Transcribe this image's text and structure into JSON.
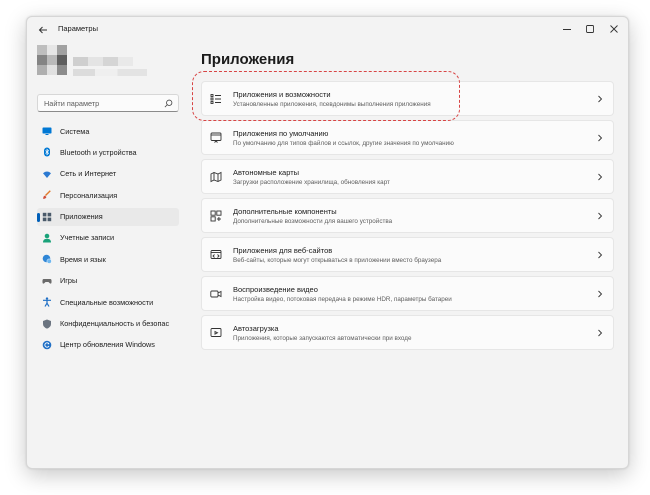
{
  "window": {
    "title": "Параметры"
  },
  "sidebar": {
    "search_placeholder": "Найти параметр",
    "items": [
      {
        "label": "Система",
        "icon": "monitor-icon",
        "color": "#0078d4"
      },
      {
        "label": "Bluetooth и устройства",
        "icon": "bluetooth-icon",
        "color": "#0078d4"
      },
      {
        "label": "Сеть и Интернет",
        "icon": "wifi-icon",
        "color": "#2b79d1"
      },
      {
        "label": "Персонализация",
        "icon": "brush-icon",
        "color": "#e07a2a"
      },
      {
        "label": "Приложения",
        "icon": "apps-icon",
        "color": "#4a5a6a",
        "active": true
      },
      {
        "label": "Учетные записи",
        "icon": "person-icon",
        "color": "#1aa37a"
      },
      {
        "label": "Время и язык",
        "icon": "globe-clock-icon",
        "color": "#2f86d6"
      },
      {
        "label": "Игры",
        "icon": "gamepad-icon",
        "color": "#6a6a6a"
      },
      {
        "label": "Специальные возможности",
        "icon": "accessibility-icon",
        "color": "#1f6fc5"
      },
      {
        "label": "Конфиденциальность и безопас",
        "icon": "shield-icon",
        "color": "#6b7480"
      },
      {
        "label": "Центр обновления Windows",
        "icon": "update-icon",
        "color": "#1f6fc5"
      }
    ]
  },
  "main": {
    "title": "Приложения",
    "cards": [
      {
        "title": "Приложения и возможности",
        "desc": "Установленные приложения, псевдонимы выполнения приложения",
        "icon": "apps-list-icon"
      },
      {
        "title": "Приложения по умолчанию",
        "desc": "По умолчанию для типов файлов и ссылок, другие значения по умолчанию",
        "icon": "default-apps-icon"
      },
      {
        "title": "Автономные карты",
        "desc": "Загрузки расположение хранилища, обновления карт",
        "icon": "map-icon"
      },
      {
        "title": "Дополнительные компоненты",
        "desc": "Дополнительные возможности для вашего устройства",
        "icon": "components-icon"
      },
      {
        "title": "Приложения для веб-сайтов",
        "desc": "Веб-сайты, которые могут открываться в приложении вместо браузера",
        "icon": "web-apps-icon"
      },
      {
        "title": "Воспроизведение видео",
        "desc": "Настройка видео, потоковая передача в режиме HDR, параметры батареи",
        "icon": "video-icon"
      },
      {
        "title": "Автозагрузка",
        "desc": "Приложения, которые запускаются автоматически при входе",
        "icon": "startup-icon"
      }
    ]
  },
  "colors": {
    "accent": "#005fb8",
    "highlight": "#d84545"
  }
}
